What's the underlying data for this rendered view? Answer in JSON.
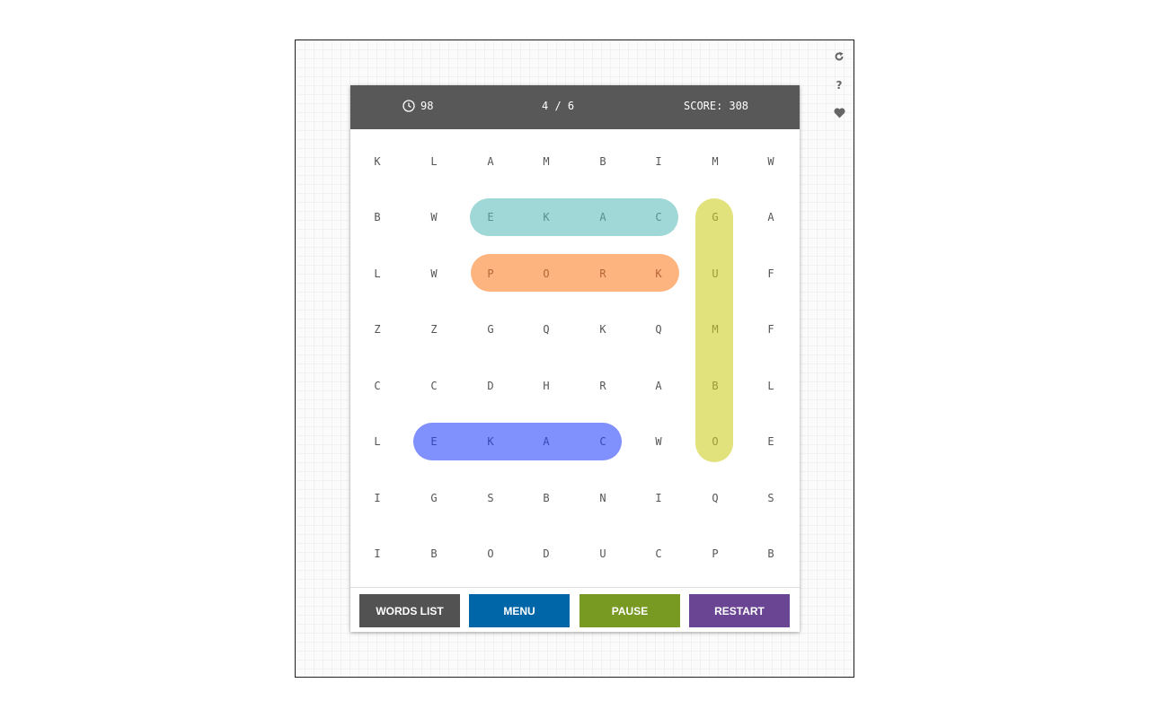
{
  "header": {
    "timer_value": "98",
    "progress": "4 / 6",
    "score_label": "SCORE:",
    "score_value": "308"
  },
  "side_icons": [
    "refresh-icon",
    "help-icon",
    "heart-icon"
  ],
  "help_symbol": "?",
  "grid": [
    [
      "K",
      "L",
      "A",
      "M",
      "B",
      "I",
      "M",
      "W"
    ],
    [
      "B",
      "W",
      "E",
      "K",
      "A",
      "C",
      "G",
      "A"
    ],
    [
      "L",
      "W",
      "P",
      "O",
      "R",
      "K",
      "U",
      "F"
    ],
    [
      "Z",
      "Z",
      "G",
      "Q",
      "K",
      "Q",
      "M",
      "F"
    ],
    [
      "C",
      "C",
      "D",
      "H",
      "R",
      "A",
      "B",
      "L"
    ],
    [
      "L",
      "E",
      "K",
      "A",
      "C",
      "W",
      "O",
      "E"
    ],
    [
      "I",
      "G",
      "S",
      "B",
      "N",
      "I",
      "Q",
      "S"
    ],
    [
      "I",
      "B",
      "O",
      "D",
      "U",
      "C",
      "P",
      "B"
    ]
  ],
  "found_words": [
    {
      "name": "found-word-cake-1",
      "color": "#9fd8d6",
      "cells": [
        [
          1,
          2
        ],
        [
          1,
          3
        ],
        [
          1,
          4
        ],
        [
          1,
          5
        ]
      ]
    },
    {
      "name": "found-word-pork",
      "color": "#fdb47e",
      "cells": [
        [
          2,
          2
        ],
        [
          2,
          3
        ],
        [
          2,
          4
        ],
        [
          2,
          5
        ]
      ]
    },
    {
      "name": "found-word-gumbo",
      "color": "#e1e27b",
      "cells": [
        [
          1,
          6
        ],
        [
          2,
          6
        ],
        [
          3,
          6
        ],
        [
          4,
          6
        ],
        [
          5,
          6
        ]
      ]
    },
    {
      "name": "found-word-cake-2",
      "color": "#8090fc",
      "cells": [
        [
          5,
          1
        ],
        [
          5,
          2
        ],
        [
          5,
          3
        ],
        [
          5,
          4
        ]
      ]
    }
  ],
  "buttons": {
    "words_list": "WORDS LIST",
    "menu": "MENU",
    "pause": "PAUSE",
    "restart": "RESTART"
  },
  "colors": {
    "header_bg": "#585858",
    "words_list_bg": "#525252",
    "menu_bg": "#0066a8",
    "pause_bg": "#789922",
    "restart_bg": "#6a4593"
  }
}
